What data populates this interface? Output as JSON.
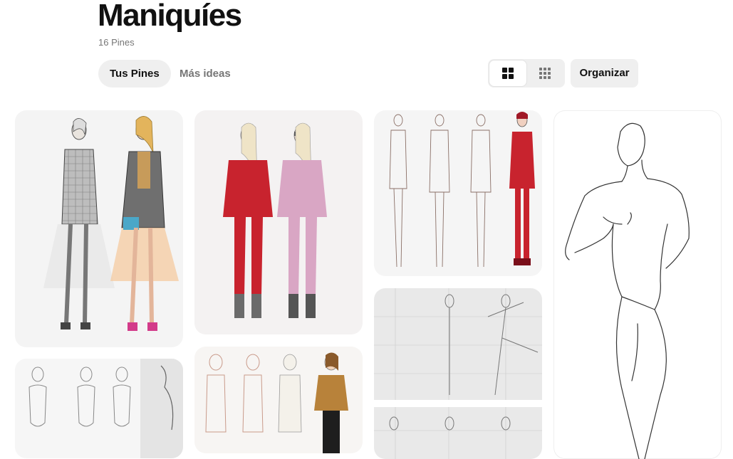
{
  "board": {
    "title": "Maniquíes",
    "pin_count": "16 Pines"
  },
  "tabs": [
    {
      "label": "Tus Pines",
      "active": true
    },
    {
      "label": "Más ideas",
      "active": false
    }
  ],
  "view_toggle": {
    "options": [
      {
        "icon": "grid-large-icon",
        "selected": true
      },
      {
        "icon": "grid-compact-icon",
        "selected": false
      }
    ]
  },
  "organize_label": "Organizar",
  "colors": {
    "tab_active_bg": "#efefef",
    "muted_text": "#767676",
    "pin_bg": "#f3f3f3",
    "accent_red": "#c8232e",
    "accent_pink": "#d9a6c4"
  },
  "pins": [
    {
      "subject": "fashion-sketch-plaid-coats"
    },
    {
      "subject": "fashion-sketch-croquis-rows"
    },
    {
      "subject": "fashion-sketch-red-pink-suits"
    },
    {
      "subject": "fashion-sketch-brown-jackets"
    },
    {
      "subject": "fashion-sketch-red-suit-lineup"
    },
    {
      "subject": "proportion-guide-numbered"
    },
    {
      "subject": "female-croquis-outline"
    }
  ]
}
